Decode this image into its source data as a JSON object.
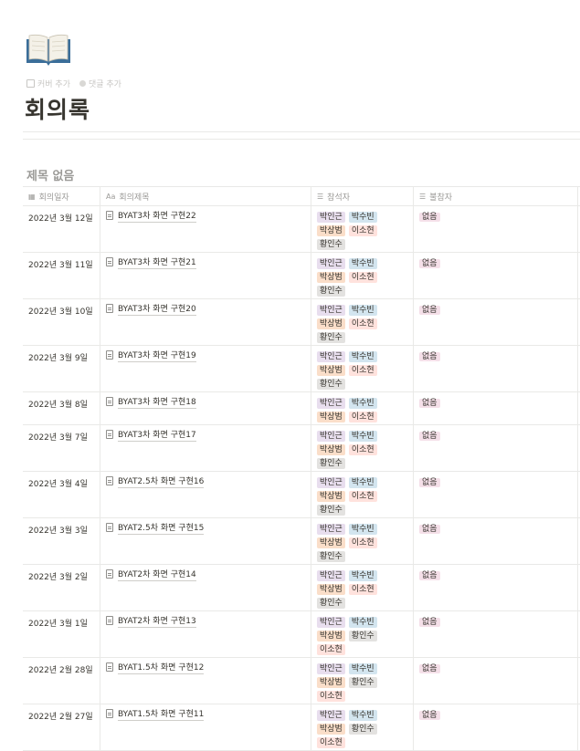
{
  "page": {
    "icon": "open-book-icon",
    "actions": [
      {
        "label": "커버 추가",
        "icon": "image-icon"
      },
      {
        "label": "댓글 추가",
        "icon": "comment-icon"
      }
    ],
    "title": "회의록"
  },
  "view": {
    "title": "제목 없음"
  },
  "columns": [
    {
      "label": "회의일자",
      "icon": "calendar-icon"
    },
    {
      "label": "회의제목",
      "icon": "text-aa-icon"
    },
    {
      "label": "참석자",
      "icon": "list-icon"
    },
    {
      "label": "불참자",
      "icon": "list-icon"
    }
  ],
  "rows": [
    {
      "date": "2022년 3월 12일",
      "title": "BYAT3차 화면 구현22",
      "attendees": [
        "박인근",
        "박수빈",
        "박상범",
        "이소현",
        "황인수"
      ],
      "absent": [
        "없음"
      ]
    },
    {
      "date": "2022년 3월 11일",
      "title": "BYAT3차 화면 구현21",
      "attendees": [
        "박인근",
        "박수빈",
        "박상범",
        "이소현",
        "황인수"
      ],
      "absent": [
        "없음"
      ]
    },
    {
      "date": "2022년 3월 10일",
      "title": "BYAT3차 화면 구현20",
      "attendees": [
        "박인근",
        "박수빈",
        "박상범",
        "이소현",
        "황인수"
      ],
      "absent": [
        "없음"
      ]
    },
    {
      "date": "2022년 3월 9일",
      "title": "BYAT3차 화면 구현19",
      "attendees": [
        "박인근",
        "박수빈",
        "박상범",
        "이소현",
        "황인수"
      ],
      "absent": [
        "없음"
      ]
    },
    {
      "date": "2022년 3월 8일",
      "title": "BYAT3차 화면 구현18",
      "attendees": [
        "박인근",
        "박수빈",
        "박상범",
        "이소현"
      ],
      "absent": [
        "없음"
      ]
    },
    {
      "date": "2022년 3월 7일",
      "title": "BYAT3차 화면 구현17",
      "attendees": [
        "박인근",
        "박수빈",
        "박상범",
        "이소현",
        "황인수"
      ],
      "absent": [
        "없음"
      ]
    },
    {
      "date": "2022년 3월 4일",
      "title": "BYAT2.5차 화면 구현16",
      "attendees": [
        "박인근",
        "박수빈",
        "박상범",
        "이소현",
        "황인수"
      ],
      "absent": [
        "없음"
      ]
    },
    {
      "date": "2022년 3월 3일",
      "title": "BYAT2.5차 화면 구현15",
      "attendees": [
        "박인근",
        "박수빈",
        "박상범",
        "이소현",
        "황인수"
      ],
      "absent": [
        "없음"
      ]
    },
    {
      "date": "2022년 3월 2일",
      "title": "BYAT2차 화면 구현14",
      "attendees": [
        "박인근",
        "박수빈",
        "박상범",
        "이소현",
        "황인수"
      ],
      "absent": [
        "없음"
      ]
    },
    {
      "date": "2022년 3월 1일",
      "title": "BYAT2차 화면 구현13",
      "attendees": [
        "박인근",
        "박수빈",
        "박상범",
        "황인수",
        "이소현"
      ],
      "absent": [
        "없음"
      ]
    },
    {
      "date": "2022년 2월 28일",
      "title": "BYAT1.5차 화면 구현12",
      "attendees": [
        "박인근",
        "박수빈",
        "박상범",
        "황인수",
        "이소현"
      ],
      "absent": [
        "없음"
      ]
    },
    {
      "date": "2022년 2월 27일",
      "title": "BYAT1.5차 화면 구현11",
      "attendees": [
        "박인근",
        "박수빈",
        "박상범",
        "황인수",
        "이소현"
      ],
      "absent": [
        "없음"
      ]
    }
  ],
  "tag_colors": {
    "박인근": "#e8deee",
    "박수빈": "#d3e5ef",
    "박상범": "#fadec9",
    "이소현": "#ffe2dd",
    "황인수": "#e3e2e0",
    "없음": "#f5e0e9"
  }
}
